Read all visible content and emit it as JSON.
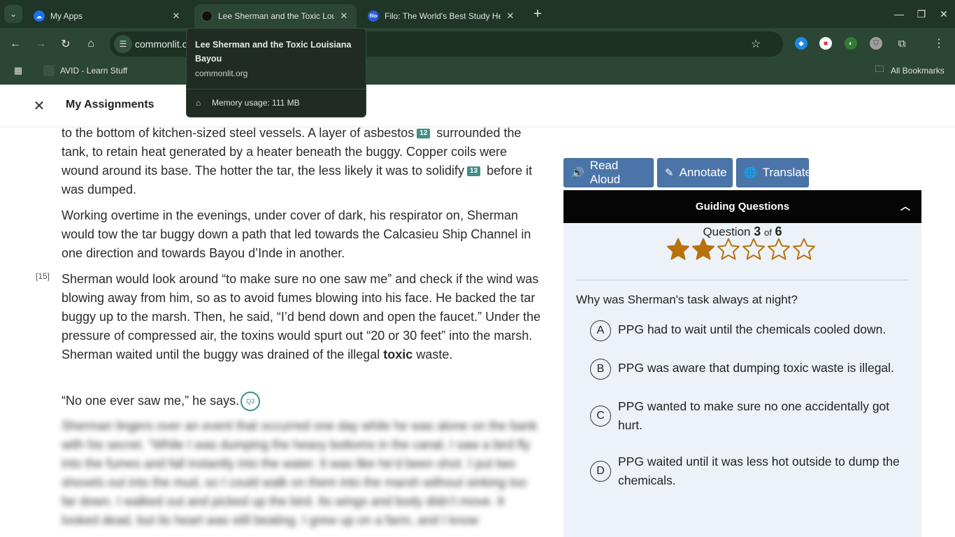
{
  "browser": {
    "tabs": [
      {
        "title": "My Apps",
        "favicon": "cloud-icon"
      },
      {
        "title": "Lee Sherman and the Toxic Louisiana Bayou",
        "favicon": "commonlit-icon"
      },
      {
        "title": "Filo: The World's Best Study Help",
        "favicon": "filo-icon"
      }
    ],
    "url": "commonlit.c",
    "bookmarks": [
      {
        "label": "AVID - Learn Stuff"
      },
      {
        "label": "All Bookmarks"
      }
    ]
  },
  "tooltip": {
    "title": "Lee Sherman and the Toxic Louisiana Bayou",
    "domain": "commonlit.org",
    "memory": "Memory usage: 111 MB"
  },
  "app": {
    "title": "My Assignments"
  },
  "reading": {
    "p1_a": "to the bottom of kitchen-sized steel vessels. A layer of asbestos",
    "fn12": "12",
    "p1_b": " surrounded the tank, to retain heat generated by a heater beneath the buggy. Copper coils were wound around its base. The hotter the tar, the less likely it was to solidify",
    "fn13": "13",
    "p1_c": " before it was dumped.",
    "p2": "Working overtime in the evenings, under cover of dark, his respirator on, Sherman would tow the tar buggy down a path that led towards the Calcasieu Ship Channel in one direction and towards Bayou d’Inde in another.",
    "pnum": "[15]",
    "p3_a": "Sherman would look around “to make sure no one saw me” and check if the wind was blowing away from him, so as to avoid fumes blowing into his face. He backed the tar buggy up to the marsh. Then, he said, “I’d bend down and open the faucet.” Under the pressure of compressed air, the toxins would spurt out “20 or 30 feet” into the marsh. Sherman waited until the buggy was drained of the illegal ",
    "p3_bold": "toxic",
    "p3_b": " waste.",
    "p4": "“No one ever saw me,” he says.",
    "q3_marker": "Q3",
    "blurred": "Sherman lingers over an event that occurred one day while he was alone on the bank with his secret. “While I was dumping the heavy bottoms in the canal, I saw a bird fly into the fumes and fall instantly into the water. It was like he’d been shot. I put two shovels out into the mud, so I could walk on them into the marsh without sinking too far down. I walked out and picked up the bird. Its wings and body didn’t move. It looked dead, but its heart was still beating. I grew up on a farm, and I know"
  },
  "tools": {
    "read_aloud": "Read Aloud",
    "annotate": "Annotate",
    "translate": "Translate"
  },
  "guiding": {
    "header": "Guiding Questions",
    "question_label": "Question",
    "current": "3",
    "of": "of",
    "total": "6",
    "filled_stars": 2,
    "total_stars": 6,
    "question": "Why was Sherman's task always at night?",
    "choices": [
      {
        "letter": "A",
        "text": "PPG had to wait until the chemicals cooled down."
      },
      {
        "letter": "B",
        "text": "PPG was aware that dumping toxic waste is illegal."
      },
      {
        "letter": "C",
        "text": "PPG wanted to make sure no one accidentally got hurt."
      },
      {
        "letter": "D",
        "text": "PPG waited until it was less hot outside to dump the chemicals."
      }
    ]
  },
  "colors": {
    "accent": "#4b75a8",
    "star": "#b8720a",
    "footnote": "#3f8f86"
  }
}
